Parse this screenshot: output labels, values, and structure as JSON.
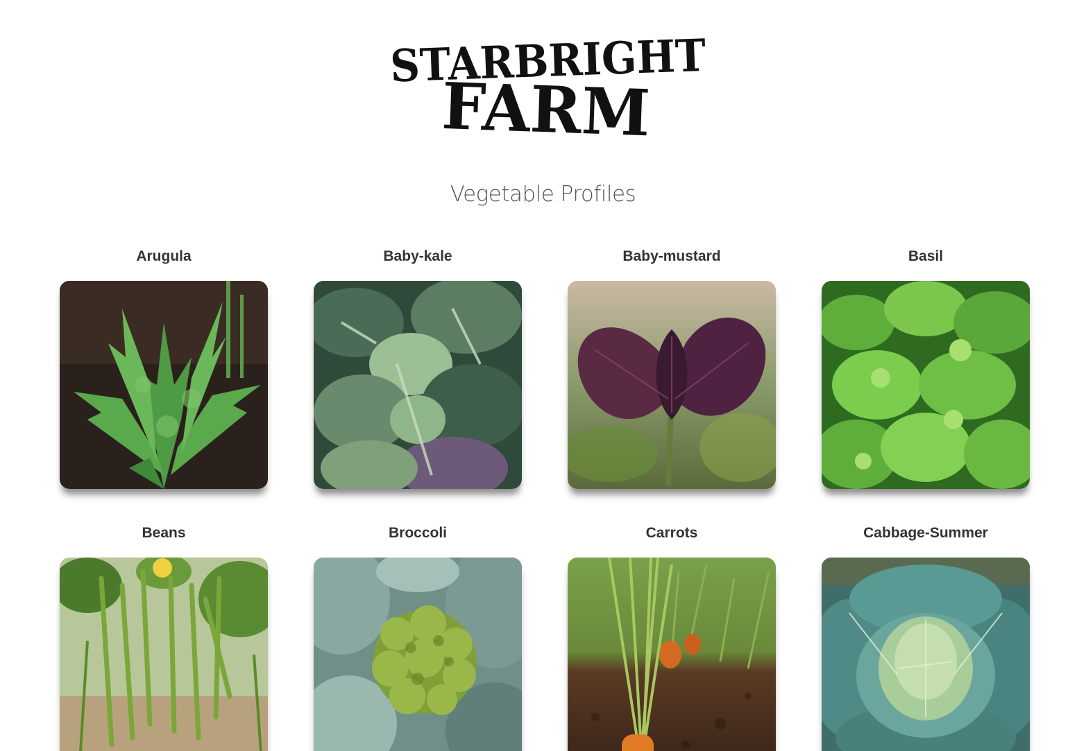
{
  "brand": {
    "logo_line1": "STARBRIGHT",
    "logo_line2": "FARM"
  },
  "section_title": "Vegetable Profiles",
  "vegetables": [
    {
      "name": "Arugula",
      "icon": "arugula-image"
    },
    {
      "name": "Baby-kale",
      "icon": "baby-kale-image"
    },
    {
      "name": "Baby-mustard",
      "icon": "baby-mustard-image"
    },
    {
      "name": "Basil",
      "icon": "basil-image"
    },
    {
      "name": "Beans",
      "icon": "beans-image"
    },
    {
      "name": "Broccoli",
      "icon": "broccoli-image"
    },
    {
      "name": "Carrots",
      "icon": "carrots-image"
    },
    {
      "name": "Cabbage-Summer",
      "icon": "cabbage-summer-image"
    }
  ],
  "colors": {
    "title_text": "#333333",
    "heading_text": "#555555",
    "background": "#ffffff"
  }
}
